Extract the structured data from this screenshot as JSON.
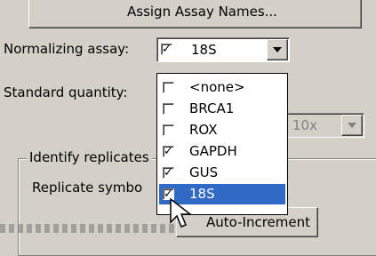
{
  "top_button": {
    "label": "Assign Assay Names..."
  },
  "normalizing": {
    "label": "Normalizing assay:",
    "selected": "18S",
    "checked": true
  },
  "standard": {
    "label": "Standard quantity:"
  },
  "dilution": {
    "value": "10x"
  },
  "group": {
    "title": "Identify replicates"
  },
  "replicate": {
    "label": "Replicate symbo"
  },
  "auto_increment": {
    "label": "Auto-Increment"
  },
  "dropdown": {
    "items": [
      {
        "label": "<none>",
        "checked": false,
        "selected": false
      },
      {
        "label": "BRCA1",
        "checked": false,
        "selected": false
      },
      {
        "label": "ROX",
        "checked": false,
        "selected": false
      },
      {
        "label": "GAPDH",
        "checked": true,
        "selected": false
      },
      {
        "label": "GUS",
        "checked": true,
        "selected": false
      },
      {
        "label": "18S",
        "checked": true,
        "selected": true
      }
    ]
  },
  "colors": {
    "selection": "#316ac5",
    "face": "#d4d0c8"
  }
}
